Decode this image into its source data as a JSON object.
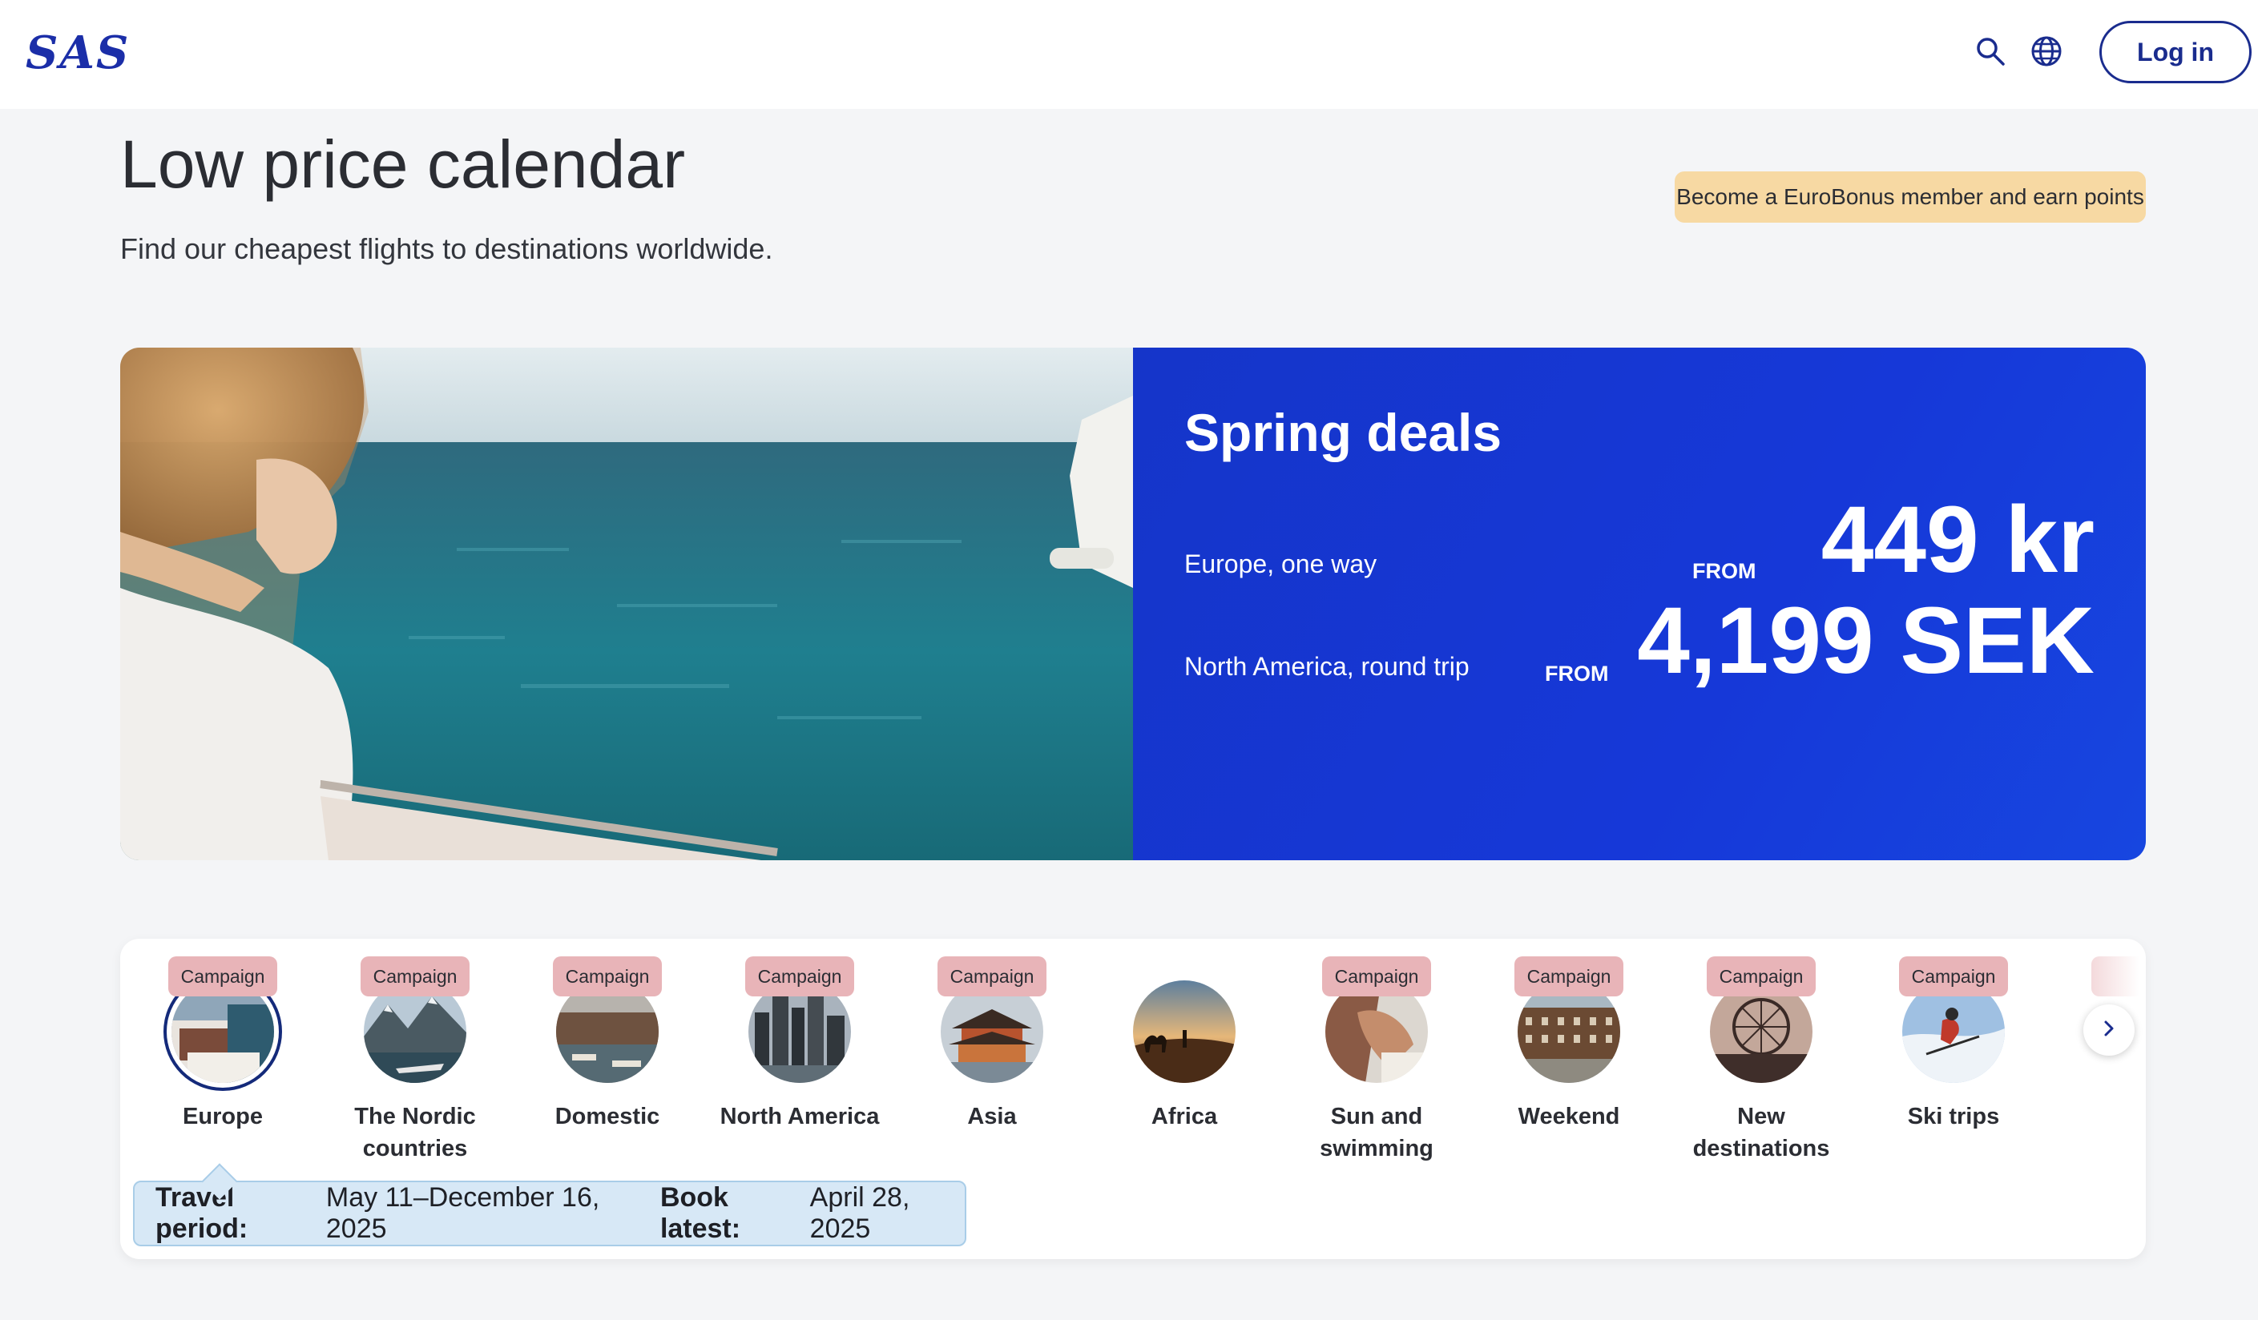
{
  "header": {
    "logo_text": "SAS",
    "icons": [
      "search-icon",
      "globe-icon"
    ],
    "login_label": "Log in"
  },
  "intro": {
    "title": "Low price calendar",
    "subtitle": "Find our cheapest flights to destinations worldwide.",
    "eurobonus_badge": "Become a EuroBonus member and earn points"
  },
  "hero": {
    "title": "Spring deals",
    "deals": [
      {
        "label": "Europe, one way",
        "from": "FROM",
        "price": "449 kr"
      },
      {
        "label": "North America, round trip",
        "from": "FROM",
        "price": "4,199 SEK"
      }
    ]
  },
  "categories": {
    "items": [
      {
        "label": "Europe",
        "badge": "Campaign",
        "selected": true
      },
      {
        "label": "The Nordic countries",
        "badge": "Campaign"
      },
      {
        "label": "Domestic",
        "badge": "Campaign"
      },
      {
        "label": "North America",
        "badge": "Campaign"
      },
      {
        "label": "Asia",
        "badge": "Campaign"
      },
      {
        "label": "Africa",
        "badge": ""
      },
      {
        "label": "Sun and swimming",
        "badge": "Campaign"
      },
      {
        "label": "Weekend",
        "badge": "Campaign"
      },
      {
        "label": "New destinations",
        "badge": "Campaign"
      },
      {
        "label": "Ski trips",
        "badge": "Campaign"
      }
    ],
    "next_icon": "chevron-right-icon",
    "info": {
      "travel_label": "Travel period:",
      "travel_value": "May 11–December 16, 2025",
      "book_label": "Book latest:",
      "book_value": "April 28, 2025"
    }
  },
  "colors": {
    "brand_blue": "#1b2ea8",
    "deal_panel": "#1638d8",
    "eurobonus_badge": "#f7d9a3",
    "campaign_badge": "#e8b4b8",
    "info_box": "#d7e8f6"
  }
}
